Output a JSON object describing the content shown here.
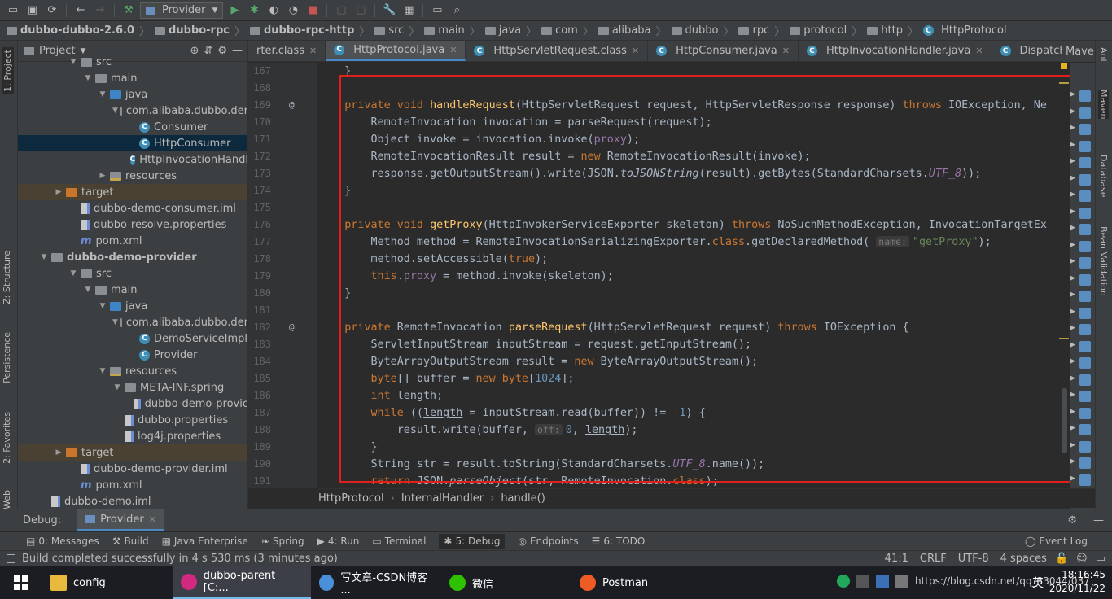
{
  "toolbar": {
    "run_config": "Provider"
  },
  "breadcrumb": [
    "dubbo-dubbo-2.6.0",
    "dubbo-rpc",
    "dubbo-rpc-http",
    "src",
    "main",
    "java",
    "com",
    "alibaba",
    "dubbo",
    "rpc",
    "protocol",
    "http",
    "HttpProtocol"
  ],
  "project_panel": {
    "title": "Project"
  },
  "tree": [
    {
      "label": "src",
      "indent": 4,
      "kind": "folder",
      "arrow": "down"
    },
    {
      "label": "main",
      "indent": 5,
      "kind": "folder",
      "arrow": "down"
    },
    {
      "label": "java",
      "indent": 6,
      "kind": "folder-blue",
      "arrow": "down"
    },
    {
      "label": "com.alibaba.dubbo.der",
      "indent": 7,
      "kind": "pkg",
      "arrow": "down"
    },
    {
      "label": "Consumer",
      "indent": 8,
      "kind": "class",
      "arrow": ""
    },
    {
      "label": "HttpConsumer",
      "indent": 8,
      "kind": "class",
      "arrow": "",
      "state": "sel"
    },
    {
      "label": "HttpInvocationHandl",
      "indent": 8,
      "kind": "class",
      "arrow": ""
    },
    {
      "label": "resources",
      "indent": 6,
      "kind": "folder-res",
      "arrow": "right"
    },
    {
      "label": "target",
      "indent": 3,
      "kind": "folder-orange",
      "arrow": "right",
      "state": "excl"
    },
    {
      "label": "dubbo-demo-consumer.iml",
      "indent": 4,
      "kind": "file",
      "arrow": ""
    },
    {
      "label": "dubbo-resolve.properties",
      "indent": 4,
      "kind": "file",
      "arrow": ""
    },
    {
      "label": "pom.xml",
      "indent": 4,
      "kind": "maven",
      "arrow": ""
    },
    {
      "label": "dubbo-demo-provider",
      "indent": 2,
      "kind": "folder",
      "arrow": "down",
      "bold": true
    },
    {
      "label": "src",
      "indent": 4,
      "kind": "folder",
      "arrow": "down"
    },
    {
      "label": "main",
      "indent": 5,
      "kind": "folder",
      "arrow": "down"
    },
    {
      "label": "java",
      "indent": 6,
      "kind": "folder-blue",
      "arrow": "down"
    },
    {
      "label": "com.alibaba.dubbo.der",
      "indent": 7,
      "kind": "pkg",
      "arrow": "down"
    },
    {
      "label": "DemoServiceImpl",
      "indent": 8,
      "kind": "class",
      "arrow": ""
    },
    {
      "label": "Provider",
      "indent": 8,
      "kind": "class",
      "arrow": ""
    },
    {
      "label": "resources",
      "indent": 6,
      "kind": "folder-res",
      "arrow": "down"
    },
    {
      "label": "META-INF.spring",
      "indent": 7,
      "kind": "pkg",
      "arrow": "down"
    },
    {
      "label": "dubbo-demo-provic",
      "indent": 8,
      "kind": "file",
      "arrow": ""
    },
    {
      "label": "dubbo.properties",
      "indent": 7,
      "kind": "file",
      "arrow": ""
    },
    {
      "label": "log4j.properties",
      "indent": 7,
      "kind": "file",
      "arrow": ""
    },
    {
      "label": "target",
      "indent": 3,
      "kind": "folder-orange",
      "arrow": "right",
      "state": "excl"
    },
    {
      "label": "dubbo-demo-provider.iml",
      "indent": 4,
      "kind": "file",
      "arrow": ""
    },
    {
      "label": "pom.xml",
      "indent": 4,
      "kind": "maven",
      "arrow": ""
    },
    {
      "label": "dubbo-demo.iml",
      "indent": 2,
      "kind": "file",
      "arrow": ""
    }
  ],
  "editor_tabs": [
    {
      "label": "rter.class",
      "active": false
    },
    {
      "label": "HttpProtocol.java",
      "active": true
    },
    {
      "label": "HttpServletRequest.class",
      "active": false
    },
    {
      "label": "HttpConsumer.java",
      "active": false
    },
    {
      "label": "HttpInvocationHandler.java",
      "active": false
    },
    {
      "label": "DispatcherServlet.java",
      "active": false
    }
  ],
  "tabs_overflow": "≡4",
  "maven_label": "Maven",
  "line_numbers": [
    "167",
    "168",
    "169",
    "170",
    "171",
    "172",
    "173",
    "174",
    "175",
    "176",
    "177",
    "178",
    "179",
    "180",
    "181",
    "182",
    "183",
    "184",
    "185",
    "186",
    "187",
    "188",
    "189",
    "190",
    "191"
  ],
  "gutter_marks": {
    "169": "@",
    "182": "@"
  },
  "code_lines": [
    [
      [
        "p",
        "    }"
      ]
    ],
    [],
    [
      [
        "p",
        "    "
      ],
      [
        "k",
        "private void "
      ],
      [
        "f",
        "handleRequest"
      ],
      [
        "p",
        "(HttpServletRequest request, HttpServletResponse response) "
      ],
      [
        "k",
        "throws "
      ],
      [
        "p",
        "IOException, Ne"
      ]
    ],
    [
      [
        "p",
        "        RemoteInvocation invocation = parseRequest(request);"
      ]
    ],
    [
      [
        "p",
        "        Object invoke = invocation.invoke("
      ],
      [
        "v",
        "proxy"
      ],
      [
        "p",
        ");"
      ]
    ],
    [
      [
        "p",
        "        RemoteInvocationResult result = "
      ],
      [
        "k",
        "new "
      ],
      [
        "p",
        "RemoteInvocationResult(invoke);"
      ]
    ],
    [
      [
        "p",
        "        response.getOutputStream().write(JSON."
      ],
      [
        "i",
        "toJSONString"
      ],
      [
        "p",
        "(result).getBytes(StandardCharsets."
      ],
      [
        "iv",
        "UTF_8"
      ],
      [
        "p",
        "));"
      ]
    ],
    [
      [
        "p",
        "    }"
      ]
    ],
    [],
    [
      [
        "p",
        "    "
      ],
      [
        "k",
        "private void "
      ],
      [
        "f",
        "getProxy"
      ],
      [
        "p",
        "(HttpInvokerServiceExporter skeleton) "
      ],
      [
        "k",
        "throws "
      ],
      [
        "p",
        "NoSuchMethodException, InvocationTargetEx"
      ]
    ],
    [
      [
        "p",
        "        Method method = RemoteInvocationSerializingExporter."
      ],
      [
        "k",
        "class"
      ],
      [
        "p",
        ".getDeclaredMethod( "
      ],
      [
        "h",
        "name:"
      ],
      [
        "s",
        "\"getProxy\""
      ],
      [
        "p",
        ");"
      ]
    ],
    [
      [
        "p",
        "        method.setAccessible("
      ],
      [
        "k",
        "true"
      ],
      [
        "p",
        ");"
      ]
    ],
    [
      [
        "p",
        "        "
      ],
      [
        "k",
        "this"
      ],
      [
        "p",
        "."
      ],
      [
        "v",
        "proxy"
      ],
      [
        "p",
        " = method.invoke(skeleton);"
      ]
    ],
    [
      [
        "p",
        "    }"
      ]
    ],
    [],
    [
      [
        "p",
        "    "
      ],
      [
        "k",
        "private "
      ],
      [
        "p",
        "RemoteInvocation "
      ],
      [
        "f",
        "parseRequest"
      ],
      [
        "p",
        "(HttpServletRequest request) "
      ],
      [
        "k",
        "throws "
      ],
      [
        "p",
        "IOException {"
      ]
    ],
    [
      [
        "p",
        "        ServletInputStream inputStream = request.getInputStream();"
      ]
    ],
    [
      [
        "p",
        "        ByteArrayOutputStream result = "
      ],
      [
        "k",
        "new "
      ],
      [
        "p",
        "ByteArrayOutputStream();"
      ]
    ],
    [
      [
        "p",
        "        "
      ],
      [
        "k",
        "byte"
      ],
      [
        "p",
        "[] buffer = "
      ],
      [
        "k",
        "new byte"
      ],
      [
        "p",
        "["
      ],
      [
        "n",
        "1024"
      ],
      [
        "p",
        "];"
      ]
    ],
    [
      [
        "p",
        "        "
      ],
      [
        "k",
        "int "
      ],
      [
        "u",
        "length"
      ],
      [
        "p",
        ";"
      ]
    ],
    [
      [
        "p",
        "        "
      ],
      [
        "k",
        "while "
      ],
      [
        "p",
        "(("
      ],
      [
        "u",
        "length"
      ],
      [
        "p",
        " = inputStream.read(buffer)) != -"
      ],
      [
        "n",
        "1"
      ],
      [
        "p",
        ") {"
      ]
    ],
    [
      [
        "p",
        "            result.write(buffer, "
      ],
      [
        "h",
        "off:"
      ],
      [
        "n",
        "0"
      ],
      [
        "p",
        ", "
      ],
      [
        "u",
        "length"
      ],
      [
        "p",
        ");"
      ]
    ],
    [
      [
        "p",
        "        }"
      ]
    ],
    [
      [
        "p",
        "        String str = result.toString(StandardCharsets."
      ],
      [
        "iv",
        "UTF_8"
      ],
      [
        "p",
        ".name());"
      ]
    ],
    [
      [
        "k",
        "        return "
      ],
      [
        "p",
        "JSON."
      ],
      [
        "i",
        "parseObject"
      ],
      [
        "p",
        "(str, RemoteInvocation."
      ],
      [
        "k",
        "class"
      ],
      [
        "p",
        ");"
      ]
    ]
  ],
  "editor_breadcrumb": [
    "HttpProtocol",
    "InternalHandler",
    "handle()"
  ],
  "debug_bar": {
    "label": "Debug:",
    "tab": "Provider"
  },
  "tool_buttons": [
    {
      "label": "0: Messages"
    },
    {
      "label": "Build"
    },
    {
      "label": "Java Enterprise"
    },
    {
      "label": "Spring"
    },
    {
      "label": "4: Run"
    },
    {
      "label": "Terminal"
    },
    {
      "label": "5: Debug",
      "active": true
    },
    {
      "label": "Endpoints"
    },
    {
      "label": "6: TODO"
    }
  ],
  "event_log": "Event Log",
  "status": {
    "message": "Build completed successfully in 4 s 530 ms (3 minutes ago)",
    "position": "41:1",
    "line_sep": "CRLF",
    "encoding": "UTF-8",
    "indent": "4 spaces"
  },
  "left_strip": [
    "1: Project",
    "Z: Structure",
    "Persistence",
    "2: Favorites",
    "Web"
  ],
  "right_strip": [
    "Ant",
    "Maven",
    "Database",
    "Bean Validation"
  ],
  "taskbar": {
    "items": [
      {
        "label": "config",
        "icon": "folder-icon"
      },
      {
        "label": "dubbo-parent [C:...",
        "icon": "intellij-icon",
        "active": true
      },
      {
        "label": "写文章-CSDN博客 ...",
        "icon": "chrome-icon"
      },
      {
        "label": "微信",
        "icon": "wechat-icon"
      },
      {
        "label": "Postman",
        "icon": "postman-icon"
      }
    ],
    "tray_text": "https://blog.csdn.net/qq_33044/037",
    "ime": "英",
    "time": "18:16:45",
    "date": "2020/11/22"
  },
  "colors": {
    "highlight": "#e0201d",
    "accent": "#4a88c7"
  }
}
